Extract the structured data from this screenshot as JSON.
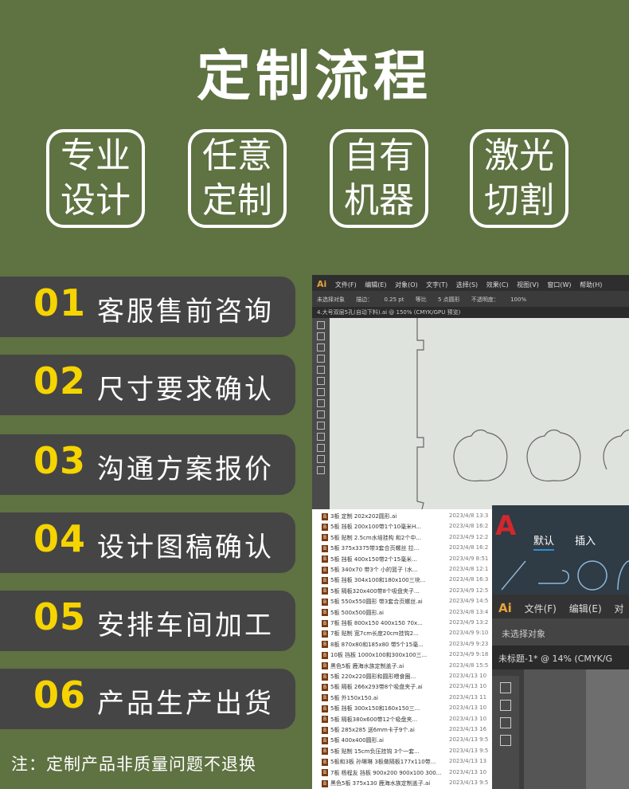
{
  "title": "定制流程",
  "features": [
    {
      "line1": "专业",
      "line2": "设计"
    },
    {
      "line1": "任意",
      "line2": "定制"
    },
    {
      "line1": "自有",
      "line2": "机器"
    },
    {
      "line1": "激光",
      "line2": "切割"
    }
  ],
  "steps": [
    {
      "num": "01",
      "label": "客服售前咨询"
    },
    {
      "num": "02",
      "label": "尺寸要求确认"
    },
    {
      "num": "03",
      "label": "沟通方案报价"
    },
    {
      "num": "04",
      "label": "设计图稿确认"
    },
    {
      "num": "05",
      "label": "安排车间加工"
    },
    {
      "num": "06",
      "label": "产品生产出货"
    }
  ],
  "note": "注：定制产品非质量问题不退换",
  "screenshot": {
    "ai_menu": [
      "文件(F)",
      "编辑(E)",
      "对象(O)",
      "文字(T)",
      "选择(S)",
      "效果(C)",
      "视图(V)",
      "窗口(W)",
      "帮助(H)"
    ],
    "ai_control": [
      "未选择对象",
      "描边：",
      "0.25 pt",
      "等比",
      "5 点圆形",
      "不透明度：",
      "100%"
    ],
    "ai_tab": "4.大号双层5孔(自动下料).ai @ 150% (CMYK/GPU 预览)",
    "files": [
      {
        "name": "3板 定制 202x202圆形.ai",
        "date": "2023/4/8 13:3"
      },
      {
        "name": "5板 挡板 200x100带1个10毫米H...",
        "date": "2023/4/8 16:2"
      },
      {
        "name": "5板 贴制 2.5cm水培挂构 和2个中...",
        "date": "2023/4/9 12:2"
      },
      {
        "name": "5板 375x3375带3套合页螺丝 拉...",
        "date": "2023/4/8 16:2"
      },
      {
        "name": "5板 挡板 400x150带2个15毫米...",
        "date": "2023/4/9 8:51"
      },
      {
        "name": "5板 340x70 带3个 小的篮子 (水...",
        "date": "2023/4/8 12:1"
      },
      {
        "name": "5板 挡板 304x100和180x100三块...",
        "date": "2023/4/8 16:3"
      },
      {
        "name": "5板 隔板320x400带8个吸盘夹子...",
        "date": "2023/4/9 12:5"
      },
      {
        "name": "5板 550x550圆形 带3套合页螺丝.ai",
        "date": "2023/4/9 14:5"
      },
      {
        "name": "5板 500x500圆形.ai",
        "date": "2023/4/8 13:4"
      },
      {
        "name": "7板 挡板 800x150 400x150 70x...",
        "date": "2023/4/9 13:2"
      },
      {
        "name": "7板 贴制 宽7cm长度20cm挂钩2...",
        "date": "2023/4/9 9:10"
      },
      {
        "name": "8板 870x80和185x80 带5个15毫...",
        "date": "2023/4/9 9:23"
      },
      {
        "name": "10板 挡板 1000x100和300x100三...",
        "date": "2023/4/9 9:18"
      },
      {
        "name": "黑色5板 鹿海水族定制盖子.ai",
        "date": "2023/4/8 15:5"
      },
      {
        "name": "5板 220x220圆形和圆形喂食圈...",
        "date": "2023/4/13 10"
      },
      {
        "name": "5板 隔板 266x293带8个吸盘夹子.ai",
        "date": "2023/4/13 10"
      },
      {
        "name": "5板 外150x150.ai",
        "date": "2023/4/13 11"
      },
      {
        "name": "5板 挡板 300x150和160x150三...",
        "date": "2023/4/13 10"
      },
      {
        "name": "5板 隔板380x600带12个吸盘夹...",
        "date": "2023/4/13 10"
      },
      {
        "name": "5板 285x285 送6mm卡子9个.ai",
        "date": "2023/4/13 16"
      },
      {
        "name": "5板 400x400圆形.ai",
        "date": "2023/4/13 9:5"
      },
      {
        "name": "5板 贴制 15cm负压挂钩 3个一套...",
        "date": "2023/4/13 9:5"
      },
      {
        "name": "5板和3板 孙琳琳 3板做隔板177x110带...",
        "date": "2023/4/13 13"
      },
      {
        "name": "7板 杨程友 挡板 900x200 900x100 300...",
        "date": "2023/4/13 10"
      },
      {
        "name": "黑色5板 375x130 鹿海水族定制盖子.ai",
        "date": "2023/4/13 9:5"
      }
    ],
    "cad_tabs": [
      "默认",
      "插入"
    ],
    "ai2_menu": [
      "文件(F)",
      "编辑(E)",
      "对"
    ],
    "ai2_control": "未选择对象",
    "ai2_doc": "未标题-1* @ 14% (CMYK/G"
  },
  "colors": {
    "background": "#5f7242",
    "step_bg": "#454545",
    "step_num": "#f5d400"
  }
}
